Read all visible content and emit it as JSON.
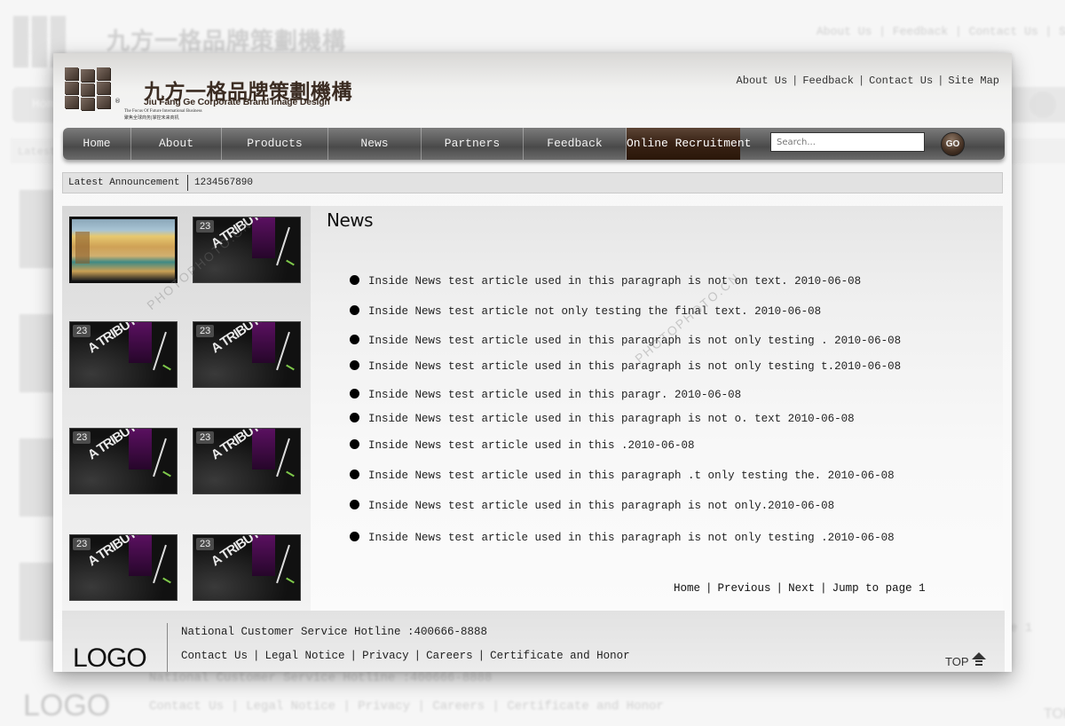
{
  "brand": {
    "name_cn": "九方一格品牌策劃機構",
    "name_en": "Jiu Fang Ge Corporate Brand Image Design",
    "registered_mark": "®",
    "tagline_en": "The Focus Of Future International Business",
    "tagline_cn": "聚焦全球商务|掌控未来商机"
  },
  "top_links": [
    "About Us",
    "Feedback",
    "Contact Us",
    "Site Map"
  ],
  "nav": {
    "items": [
      {
        "label": "Home"
      },
      {
        "label": "About"
      },
      {
        "label": "Products"
      },
      {
        "label": "News"
      },
      {
        "label": "Partners"
      },
      {
        "label": "Feedback"
      },
      {
        "label": "Online Recruitment",
        "active": true
      }
    ],
    "search_placeholder": "Search...",
    "go_label": "GO"
  },
  "announcement": {
    "label": "Latest Announcement",
    "value": "1234567890"
  },
  "gallery": {
    "thumbs": [
      {
        "type": "photo",
        "alt": "hotel lobby interior"
      },
      {
        "type": "tribute",
        "badge": "23",
        "text": "A TRIBUTE TOCLICK"
      },
      {
        "type": "tribute",
        "badge": "23",
        "text": "A TRIBUTE TOCLICK"
      },
      {
        "type": "tribute",
        "badge": "23",
        "text": "A TRIBUTE TOCLICK"
      },
      {
        "type": "tribute",
        "badge": "23",
        "text": "A TRIBUTE TOCLICK"
      },
      {
        "type": "tribute",
        "badge": "23",
        "text": "A TRIBUTE TOCLICK"
      },
      {
        "type": "tribute",
        "badge": "23",
        "text": "A TRIBUTE TOCLICK"
      },
      {
        "type": "tribute",
        "badge": "23",
        "text": "A TRIBUTE TOCLICK"
      }
    ]
  },
  "news": {
    "title": "News",
    "items": [
      "Inside News test article used in this paragraph is not on text. 2010-06-08",
      "Inside News test article not only testing the final text. 2010-06-08",
      "Inside News test article used in this paragraph is not only testing . 2010-06-08",
      "Inside News test article used in this paragraph is not only testing t.2010-06-08",
      "Inside News test article used in this paragr. 2010-06-08",
      "Inside News test article used in this paragraph is not o. text 2010-06-08",
      "Inside News test article used in this .2010-06-08",
      "Inside News test article used in this paragraph .t only testing the. 2010-06-08",
      "Inside News test article used in this paragraph is not only.2010-06-08",
      "Inside News test article used in this paragraph is not only testing .2010-06-08"
    ]
  },
  "pager": {
    "home": "Home",
    "previous": "Previous",
    "next": "Next",
    "jump": "Jump to page 1"
  },
  "footer": {
    "logo": "LOGO",
    "hotline": "National Customer Service Hotline :400666-8888",
    "links": [
      "Contact Us",
      "Legal Notice",
      "Privacy",
      "Careers",
      "Certificate and Honor"
    ],
    "top_label": "TOP"
  },
  "watermark": {
    "text": "PHOTOPHOTO.CN"
  },
  "colors": {
    "nav_active": "#3a2316",
    "brand_brown": "#3b2c22",
    "nav_gray": "#5f5f5f"
  }
}
